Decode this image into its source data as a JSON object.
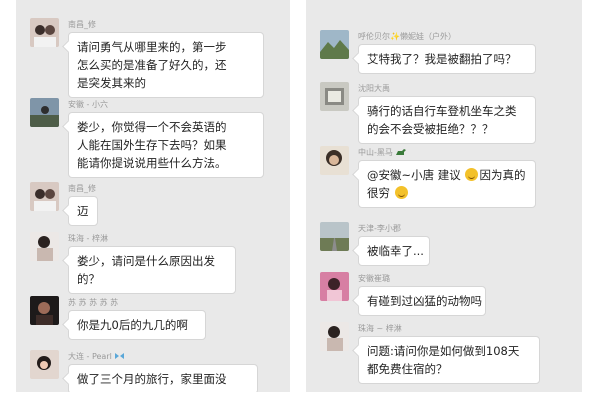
{
  "left": {
    "messages": [
      {
        "name": "南昌_修",
        "lines": [
          "请问勇气从哪里来的，第一步",
          "怎么买的是准备了好久的，还",
          "是突发其来的"
        ]
      },
      {
        "name": "安徽 - 小六",
        "lines": [
          "娄少，你觉得一个不会英语的",
          "人能在国外生存下去吗？如果",
          "能请你提说说用些什么方法。"
        ]
      },
      {
        "name": "南昌_修",
        "lines": [
          "迈"
        ]
      },
      {
        "name": "珠海 - 梓淋",
        "lines": [
          "娄少，请问是什么原因出发",
          "的？"
        ]
      },
      {
        "name": "苏 苏 苏 苏 苏",
        "lines": [
          "你是九0后的九几的啊"
        ]
      },
      {
        "name": "大连 - Pearl",
        "lines": [
          "做了三个月的旅行，家里面没"
        ]
      }
    ]
  },
  "right": {
    "messages": [
      {
        "name": "呼伦贝尔✨懒妮娃（户外）",
        "lines": [
          "艾特我了？我是被翻拍了吗？"
        ]
      },
      {
        "name": "沈阳大禹",
        "lines": [
          "骑行的话自行车登机坐车之类",
          "的会不会受被拒绝？？？"
        ]
      },
      {
        "name": "中山-黑马",
        "lines": [
          "@安徽~小唐 建议",
          "因为真的",
          "很穷"
        ]
      },
      {
        "name": "天津-李小郡",
        "lines": [
          "被临幸了..."
        ]
      },
      {
        "name": "安徽崔璐",
        "lines": [
          "有碰到过凶猛的动物吗"
        ]
      },
      {
        "name": "珠海 ~ 梓淋",
        "lines": [
          "问题:请问你是如何做到108天",
          "都免费住宿的？"
        ]
      }
    ]
  }
}
